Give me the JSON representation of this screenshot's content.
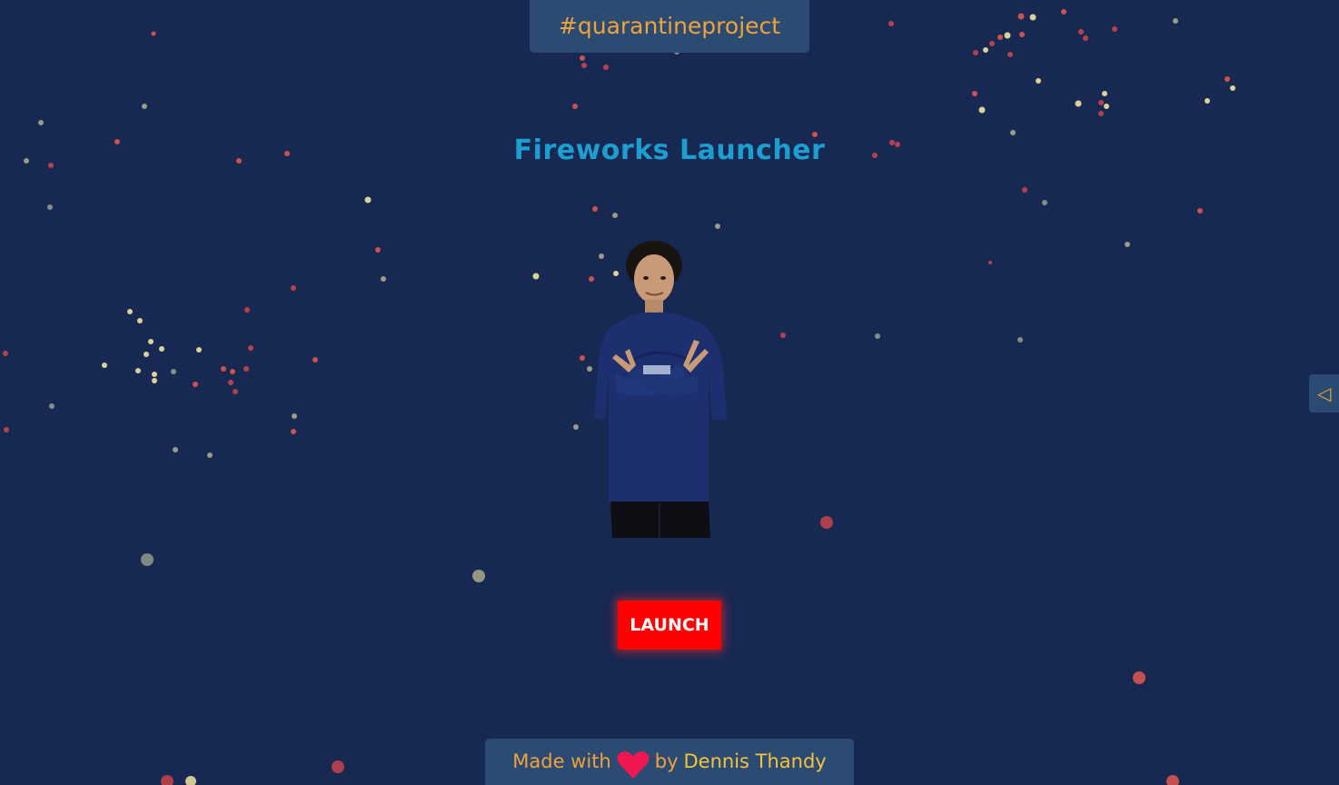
{
  "header": {
    "hashtag": "#quarantineproject"
  },
  "main": {
    "title": "Fireworks Launcher",
    "launch_label": "LAUNCH"
  },
  "side_panel": {
    "toggle_icon": "◁"
  },
  "footer": {
    "made_with": "Made with",
    "by": "by",
    "author": "Dennis Thandy"
  },
  "icons": {
    "heart": "heart-icon",
    "toggle": "triangle-left-icon"
  },
  "colors": {
    "background": "#172852",
    "panel": "#2b4b72",
    "accent_orange": "#f0a23c",
    "title_blue": "#1d9ed0",
    "launch_red": "#ff0000",
    "heart": "#f0184f",
    "author_yellow": "#f6c33a"
  }
}
